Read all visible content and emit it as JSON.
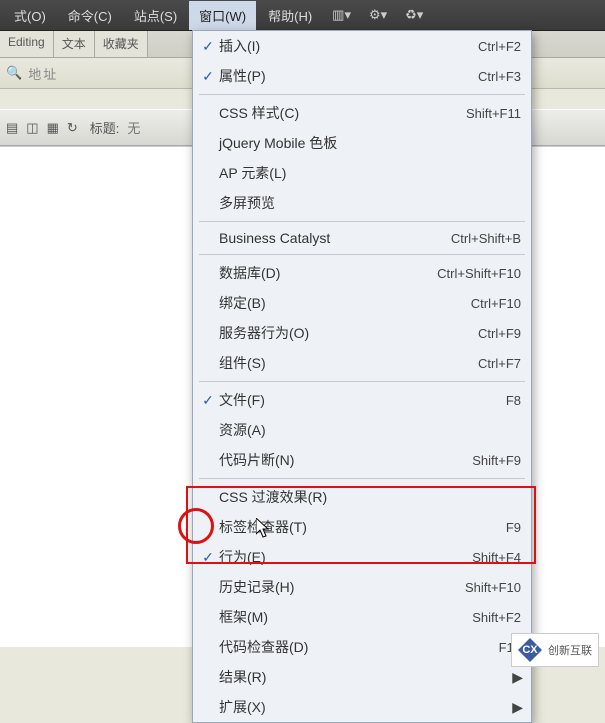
{
  "menubar": {
    "items": [
      {
        "label": "式(O)"
      },
      {
        "label": "命令(C)"
      },
      {
        "label": "站点(S)"
      },
      {
        "label": "窗口(W)",
        "active": true
      },
      {
        "label": "帮助(H)"
      }
    ]
  },
  "tabs": {
    "items": [
      {
        "label": "Editing"
      },
      {
        "label": "文本"
      },
      {
        "label": "收藏夹"
      }
    ]
  },
  "addressbar": {
    "hint": "地址"
  },
  "toolbar": {
    "title_label": "标题:",
    "title_value": "无"
  },
  "dropdown": {
    "groups": [
      [
        {
          "label": "插入(I)",
          "shortcut": "Ctrl+F2",
          "checked": true
        },
        {
          "label": "属性(P)",
          "shortcut": "Ctrl+F3",
          "checked": true
        }
      ],
      [
        {
          "label": "CSS 样式(C)",
          "shortcut": "Shift+F11"
        },
        {
          "label": "jQuery Mobile 色板",
          "shortcut": ""
        },
        {
          "label": "AP 元素(L)",
          "shortcut": ""
        },
        {
          "label": "多屏预览",
          "shortcut": ""
        }
      ],
      [
        {
          "label": "Business Catalyst",
          "shortcut": "Ctrl+Shift+B"
        }
      ],
      [
        {
          "label": "数据库(D)",
          "shortcut": "Ctrl+Shift+F10"
        },
        {
          "label": "绑定(B)",
          "shortcut": "Ctrl+F10"
        },
        {
          "label": "服务器行为(O)",
          "shortcut": "Ctrl+F9"
        },
        {
          "label": "组件(S)",
          "shortcut": "Ctrl+F7"
        }
      ],
      [
        {
          "label": "文件(F)",
          "shortcut": "F8",
          "checked": true
        },
        {
          "label": "资源(A)",
          "shortcut": ""
        },
        {
          "label": "代码片断(N)",
          "shortcut": "Shift+F9"
        }
      ],
      [
        {
          "label": "CSS 过渡效果(R)",
          "shortcut": ""
        },
        {
          "label": "标签检查器(T)",
          "shortcut": "F9"
        },
        {
          "label": "行为(E)",
          "shortcut": "Shift+F4",
          "checked": true
        },
        {
          "label": "历史记录(H)",
          "shortcut": "Shift+F10"
        },
        {
          "label": "框架(M)",
          "shortcut": "Shift+F2"
        },
        {
          "label": "代码检查器(D)",
          "shortcut": "F10"
        },
        {
          "label": "结果(R)",
          "shortcut": "",
          "submenu": true
        },
        {
          "label": "扩展(X)",
          "shortcut": "",
          "submenu": true
        }
      ]
    ]
  },
  "brand": {
    "text": "创新互联",
    "logo": "CX"
  }
}
